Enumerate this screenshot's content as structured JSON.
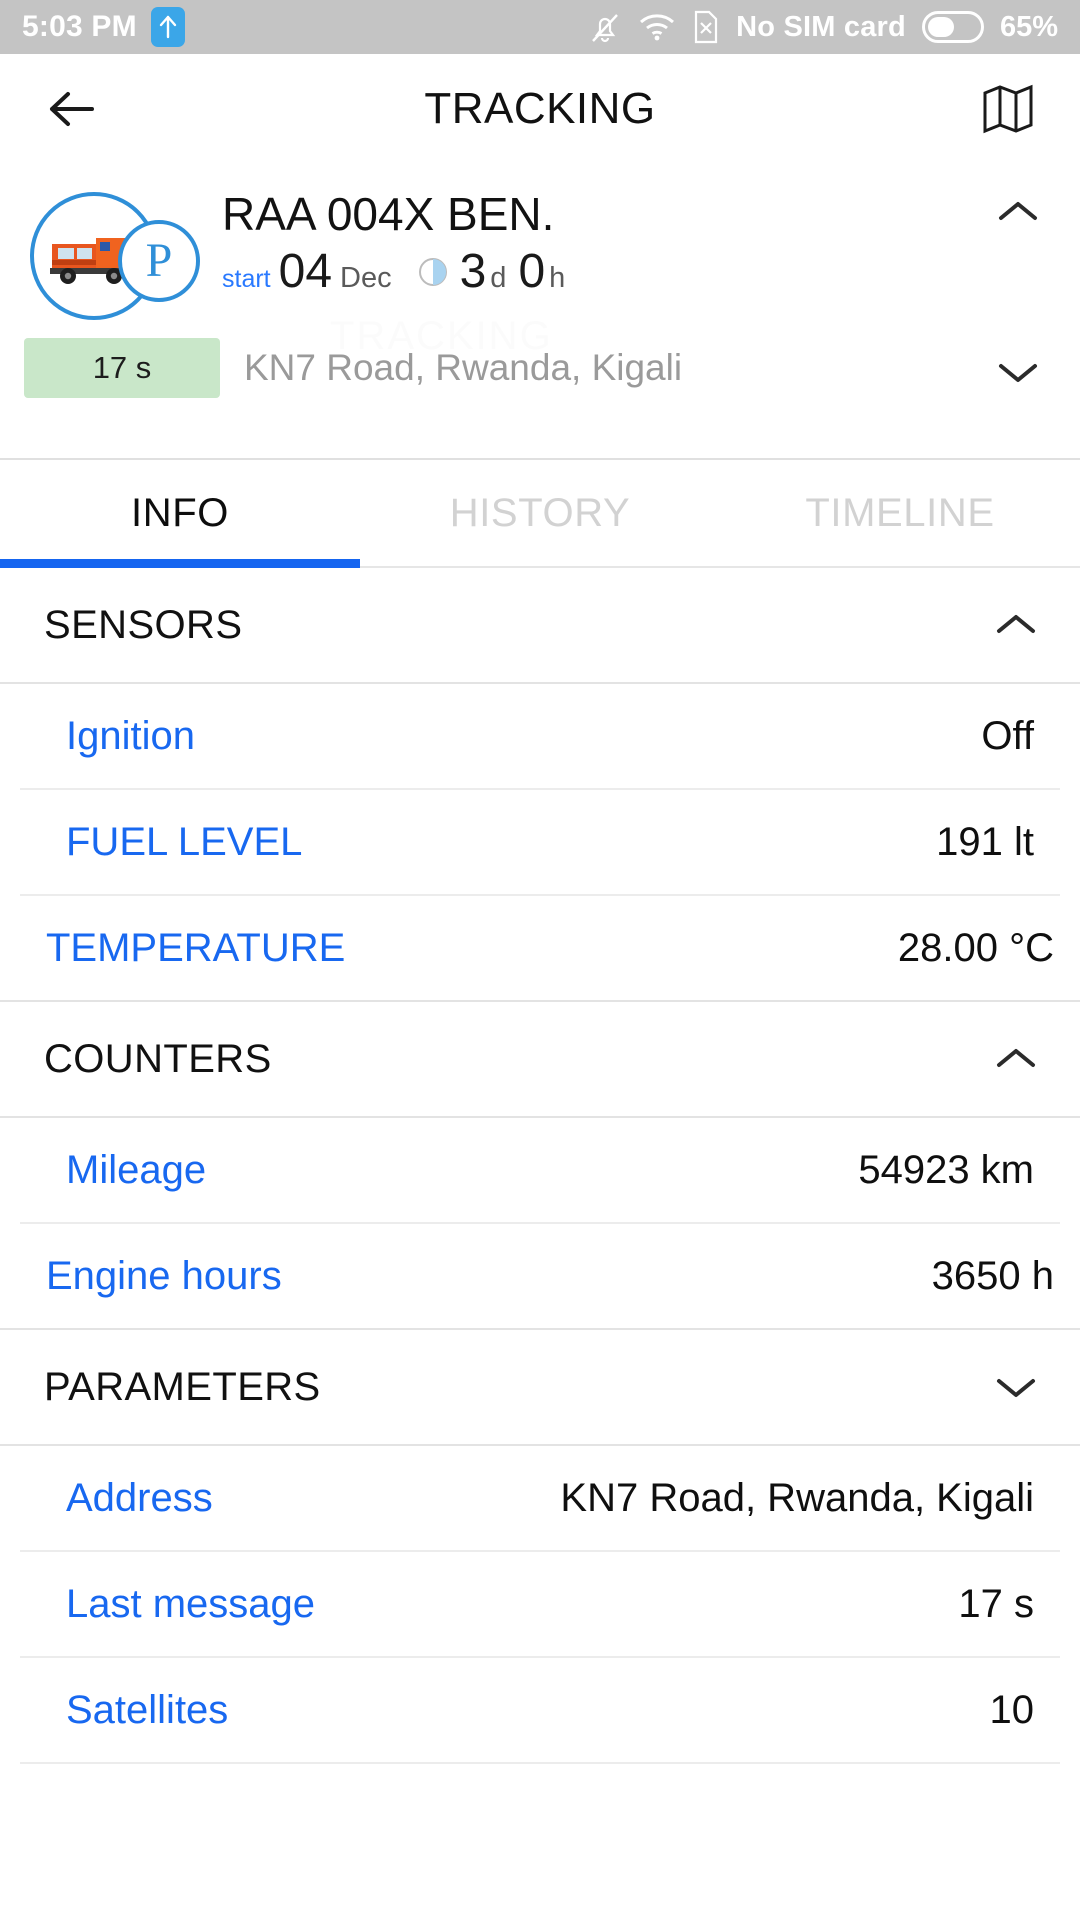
{
  "status_bar": {
    "time": "5:03 PM",
    "upload_icon": "upload-arrow-icon",
    "mute_icon": "bell-muted-icon",
    "wifi_icon": "wifi-icon",
    "sim_icon": "sim-card-x-icon",
    "sim_text": "No SIM card",
    "battery_icon": "battery-icon",
    "battery_percent": "65%",
    "background": "#c4c4c4"
  },
  "app_bar": {
    "back_icon": "back-arrow-icon",
    "title": "TRACKING",
    "map_icon": "map-icon"
  },
  "vehicle_card": {
    "avatar_icon": "truck-icon",
    "status_badge_icon": "parking-p-icon",
    "status_badge_letter": "P",
    "name": "RAA 004X BEN.",
    "start_label": "start",
    "start_day": "04",
    "start_month": "Dec",
    "duration_icon": "pie-clock-icon",
    "duration_days": "3",
    "duration_days_unit": "d",
    "duration_hours": "0",
    "duration_hours_unit": "h",
    "last_update_chip": "17 s",
    "address": "KN7 Road, Rwanda, Kigali",
    "expand_icon": "chevron-up-icon",
    "collapse_icon": "chevron-down-icon",
    "watermark": "TRACKING",
    "chip_color": "#c9e7c9",
    "accent_color": "#2f8fd8"
  },
  "tabs": [
    {
      "label": "INFO",
      "active": true
    },
    {
      "label": "HISTORY",
      "active": false
    },
    {
      "label": "TIMELINE",
      "active": false
    }
  ],
  "sections": [
    {
      "title": "SENSORS",
      "chevron": "chevron-up-icon",
      "expanded": true,
      "rows": [
        {
          "label": "Ignition",
          "value": "Off"
        },
        {
          "label": "FUEL LEVEL",
          "value": "191 lt"
        },
        {
          "label": "TEMPERATURE",
          "value": "28.00 °C"
        }
      ]
    },
    {
      "title": "COUNTERS",
      "chevron": "chevron-up-icon",
      "expanded": true,
      "rows": [
        {
          "label": "Mileage",
          "value": "54923 km"
        },
        {
          "label": "Engine hours",
          "value": "3650 h"
        }
      ]
    },
    {
      "title": "PARAMETERS",
      "chevron": "chevron-down-icon",
      "expanded": false,
      "rows": [
        {
          "label": "Address",
          "value": "KN7 Road, Rwanda, Kigali"
        },
        {
          "label": "Last message",
          "value": "17 s"
        },
        {
          "label": "Satellites",
          "value": "10"
        }
      ]
    }
  ],
  "colors": {
    "accent_blue": "#1868f0",
    "tab_underline": "#1565f0",
    "label_blue": "#1868f0",
    "muted_grey": "#9a9a9a",
    "divider": "#e3e3e3"
  }
}
